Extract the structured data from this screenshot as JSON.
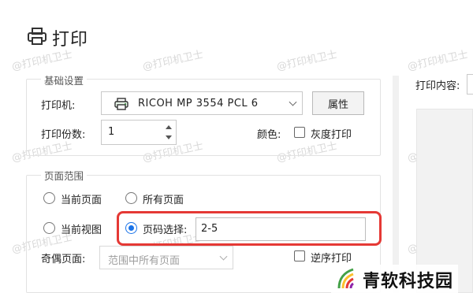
{
  "window": {
    "title": "打印"
  },
  "watermark": {
    "text": "@打印机卫士"
  },
  "basic": {
    "legend": "基础设置",
    "printer_label": "打印机:",
    "printer_value": "RICOH MP 3554 PCL 6",
    "properties_label": "属性",
    "copies_label": "打印份数:",
    "copies_value": "1",
    "color_label": "颜色:",
    "grayscale_label": "灰度打印"
  },
  "range": {
    "legend": "页面范围",
    "current_page": "当前页面",
    "all_pages": "所有页面",
    "current_view": "当前视图",
    "page_select": "页码选择:",
    "page_value": "2-5",
    "odd_even_label": "奇偶页面:",
    "odd_even_value": "范围中所有页面",
    "reverse_partial": "逆序打印"
  },
  "right": {
    "content_label": "打印内容:"
  },
  "logo": {
    "text": "青软科技园"
  },
  "colors": {
    "accent": "#1a73e8",
    "highlight": "#e53935"
  }
}
